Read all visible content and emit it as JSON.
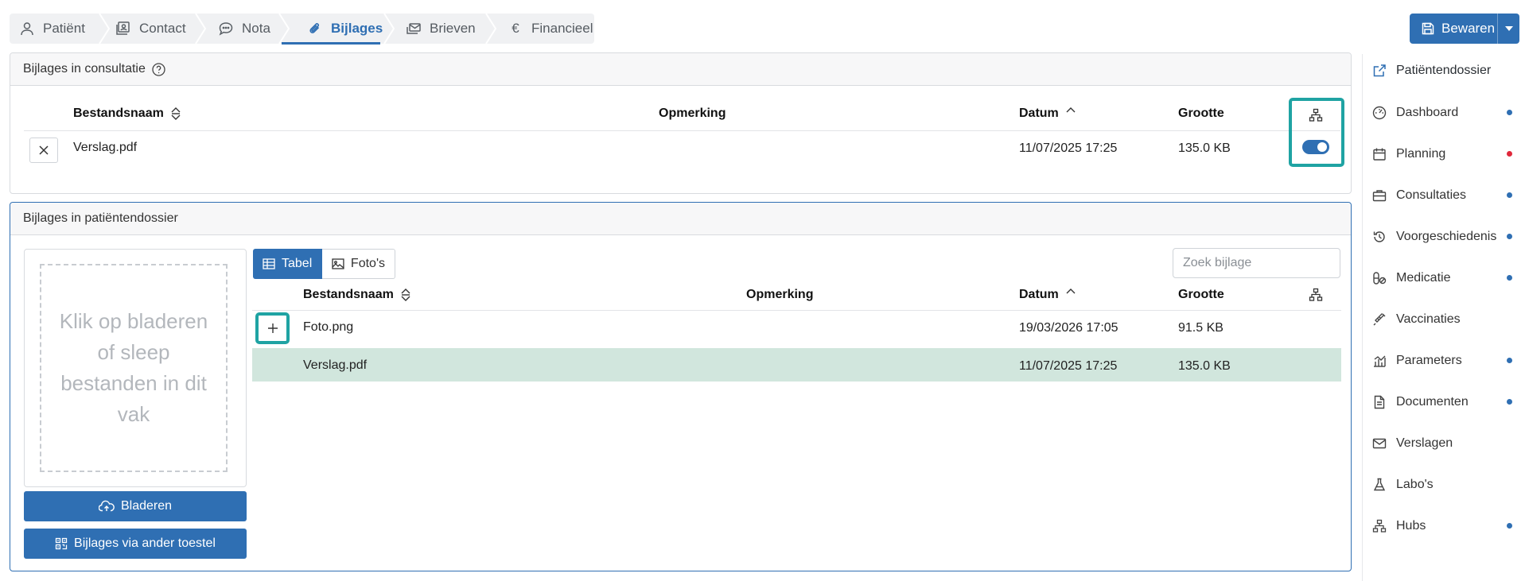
{
  "tabs": [
    {
      "label": "Patiënt",
      "icon": "person-icon"
    },
    {
      "label": "Contact",
      "icon": "contact-card-icon"
    },
    {
      "label": "Nota",
      "icon": "chat-bubble-icon"
    },
    {
      "label": "Bijlages",
      "icon": "paperclip-icon",
      "active": true
    },
    {
      "label": "Brieven",
      "icon": "letters-icon"
    },
    {
      "label": "Financieel",
      "icon": "euro-icon"
    }
  ],
  "save": {
    "label": "Bewaren"
  },
  "consultation": {
    "title": "Bijlages in consultatie",
    "columns": {
      "name": "Bestandsnaam",
      "remark": "Opmerking",
      "date": "Datum",
      "size": "Grootte"
    },
    "rows": [
      {
        "name": "Verslag.pdf",
        "remark": "",
        "date": "11/07/2025 17:25",
        "size": "135.0 KB",
        "shared": true
      }
    ]
  },
  "dossier": {
    "title": "Bijlages in patiëntendossier",
    "dropzone_text": "Klik op bladeren of sleep bestanden in dit vak",
    "browse_label": "Bladeren",
    "other_device_label": "Bijlages via ander toestel",
    "view_table_label": "Tabel",
    "view_photos_label": "Foto's",
    "search_placeholder": "Zoek bijlage",
    "columns": {
      "name": "Bestandsnaam",
      "remark": "Opmerking",
      "date": "Datum",
      "size": "Grootte"
    },
    "rows": [
      {
        "name": "Foto.png",
        "remark": "",
        "date": "19/03/2026 17:05",
        "size": "91.5 KB"
      },
      {
        "name": "Verslag.pdf",
        "remark": "",
        "date": "11/07/2025 17:25",
        "size": "135.0 KB",
        "selected": true
      }
    ]
  },
  "sidebar": {
    "items": [
      {
        "label": "Patiëntendossier",
        "icon": "external-link-icon",
        "dot": ""
      },
      {
        "label": "Dashboard",
        "icon": "gauge-icon",
        "dot": "blue"
      },
      {
        "label": "Planning",
        "icon": "calendar-icon",
        "dot": "red"
      },
      {
        "label": "Consultaties",
        "icon": "briefcase-icon",
        "dot": "blue"
      },
      {
        "label": "Voorgeschiedenis",
        "icon": "history-icon",
        "dot": "blue"
      },
      {
        "label": "Medicatie",
        "icon": "pills-icon",
        "dot": "blue"
      },
      {
        "label": "Vaccinaties",
        "icon": "syringe-icon",
        "dot": ""
      },
      {
        "label": "Parameters",
        "icon": "chart-icon",
        "dot": "blue"
      },
      {
        "label": "Documenten",
        "icon": "document-icon",
        "dot": "blue"
      },
      {
        "label": "Verslagen",
        "icon": "envelope-icon",
        "dot": ""
      },
      {
        "label": "Labo's",
        "icon": "flask-icon",
        "dot": ""
      },
      {
        "label": "Hubs",
        "icon": "hierarchy-icon",
        "dot": "blue"
      }
    ]
  },
  "colors": {
    "primary": "#2f6fb3",
    "highlight": "#1fa3a3",
    "selected_row": "#d1e6dd",
    "alert": "#e0283b"
  }
}
